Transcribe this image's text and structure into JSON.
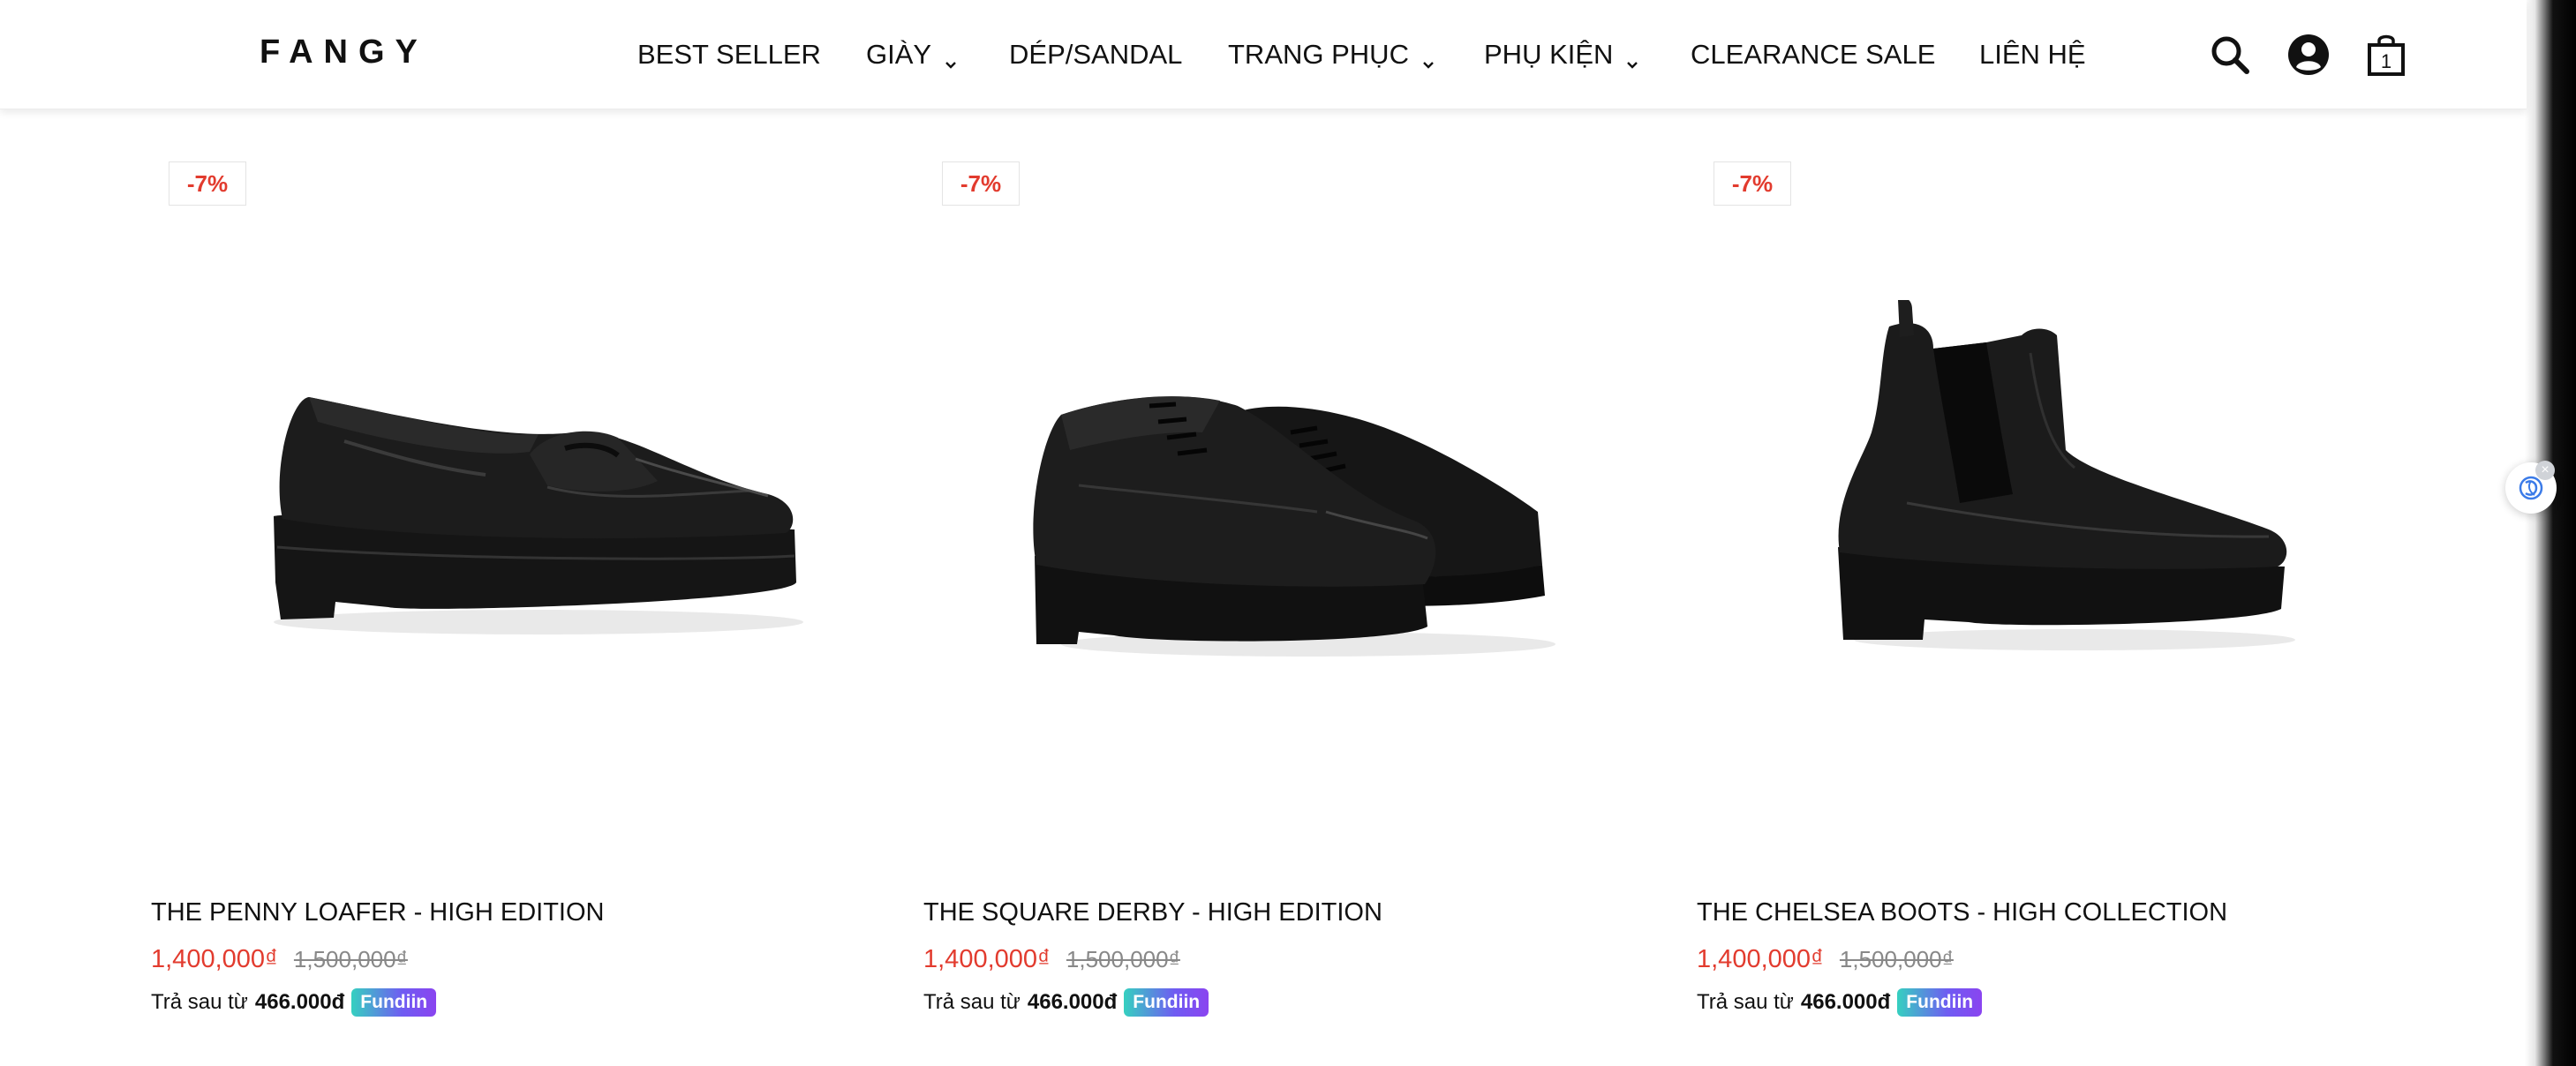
{
  "brand": {
    "logo": "FANGY"
  },
  "nav": [
    {
      "label": "BEST SELLER",
      "has_dropdown": false
    },
    {
      "label": "GIÀY",
      "has_dropdown": true
    },
    {
      "label": "DÉP/SANDAL",
      "has_dropdown": false
    },
    {
      "label": "TRANG PHỤC",
      "has_dropdown": true
    },
    {
      "label": "PHỤ KIỆN",
      "has_dropdown": true
    },
    {
      "label": "CLEARANCE SALE",
      "has_dropdown": false
    },
    {
      "label": "LIÊN HỆ",
      "has_dropdown": false
    }
  ],
  "header_icons": {
    "search": "search-icon",
    "account": "user-icon",
    "cart": "shopping-bag-icon",
    "cart_count": "1"
  },
  "products": [
    {
      "badge": "-7%",
      "image": "black-penny-loafer",
      "title": "THE PENNY LOAFER - HIGH EDITION",
      "price": "1,400,000₫",
      "old_price": "1,500,000₫",
      "pay_prefix": "Trả sau từ",
      "pay_amount": "466.000đ",
      "pay_brand": "Fundiin"
    },
    {
      "badge": "-7%",
      "image": "black-square-derby-pair",
      "title": "THE SQUARE DERBY - HIGH EDITION",
      "price": "1,400,000₫",
      "old_price": "1,500,000₫",
      "pay_prefix": "Trả sau từ",
      "pay_amount": "466.000đ",
      "pay_brand": "Fundiin"
    },
    {
      "badge": "-7%",
      "image": "black-chelsea-boot",
      "title": "THE CHELSEA BOOTS - HIGH COLLECTION",
      "price": "1,400,000₫",
      "old_price": "1,500,000₫",
      "pay_prefix": "Trả sau từ",
      "pay_amount": "466.000đ",
      "pay_brand": "Fundiin"
    }
  ],
  "colors": {
    "sale_red": "#e23b2e",
    "text": "#111111",
    "fundiin_start": "#35d0c0",
    "fundiin_end": "#8a44f0"
  },
  "floating_widget": {
    "icon": "ai-assistant-icon",
    "close_icon": "close-icon"
  }
}
